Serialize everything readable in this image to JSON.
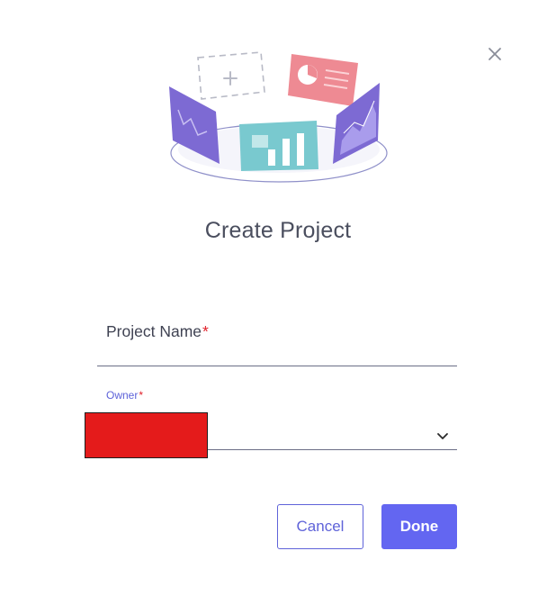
{
  "dialog": {
    "title": "Create Project",
    "close_icon": "close-icon"
  },
  "illustration": {
    "icon": "project-illustration"
  },
  "form": {
    "project_name": {
      "label": "Project Name",
      "required_marker": "*",
      "value": ""
    },
    "owner": {
      "label": "Owner",
      "required_marker": "*",
      "selected_value": "",
      "dropdown_icon": "chevron-down-icon"
    }
  },
  "actions": {
    "cancel_label": "Cancel",
    "done_label": "Done"
  },
  "colors": {
    "accent": "#6366f1",
    "required": "#e0202a",
    "redaction": "#e41b1b"
  }
}
